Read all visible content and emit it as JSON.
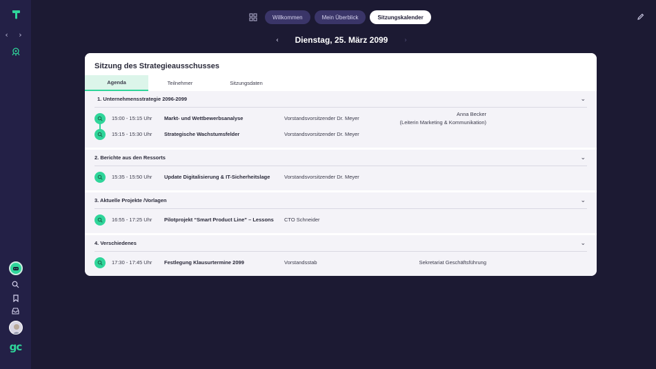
{
  "sidebar": {
    "nav_arrows": "‹ ›",
    "brand": "gc"
  },
  "topnav": {
    "tabs": [
      {
        "label": "Willkommen",
        "active": false
      },
      {
        "label": "Mein Überblick",
        "active": false
      },
      {
        "label": "Sitzungskalender",
        "active": true
      }
    ]
  },
  "date": {
    "prev": "‹",
    "label": "Dienstag, 25. März 2099",
    "next": "›"
  },
  "card": {
    "title": "Sitzung des Strategieausschusses",
    "tabs": [
      "Agenda",
      "Teilnehmer",
      "Sitzungsdaten"
    ],
    "sections": [
      {
        "title": "1. Unternehmensstrategie 2096-2099",
        "items": [
          {
            "time": "15:00 - 15:15 Uhr",
            "topic": "Markt- und Wettbewerbsanalyse",
            "presenter": "Vorstandsvorsitzender Dr. Meyer",
            "extra_1": "Anna Becker",
            "extra_2": "(Leiterin Marketing & Kommunikation)"
          },
          {
            "time": "15:15 - 15:30 Uhr",
            "topic": "Strategische Wachstumsfelder",
            "presenter": "Vorstandsvorsitzender Dr. Meyer",
            "extra_1": "",
            "extra_2": ""
          }
        ]
      },
      {
        "title": "2. Berichte aus den Ressorts",
        "items": [
          {
            "time": "15:35 - 15:50 Uhr",
            "topic": "Update Digitalisierung & IT-Sicherheitslage",
            "presenter": "Vorstandsvorsitzender Dr. Meyer",
            "extra_1": "",
            "extra_2": ""
          }
        ]
      },
      {
        "title": "3. Aktuelle Projekte /Vorlagen",
        "items": [
          {
            "time": "16:55 - 17:25 Uhr",
            "topic": "Pilotprojekt “Smart Product Line” – Lessons",
            "presenter": "CTO Schneider",
            "extra_1": "",
            "extra_2": ""
          }
        ]
      },
      {
        "title": "4. Verschiedenes",
        "items": [
          {
            "time": "17:30 - 17:45 Uhr",
            "topic": "Festlegung Klausurtermine 2099",
            "presenter": "Vorstandsstab",
            "extra_1": "Sekretariat Geschäftsführung",
            "extra_2": ""
          }
        ]
      }
    ]
  },
  "colors": {
    "background": "#1c1a33",
    "sidebar": "#232046",
    "accent": "#2fd59a",
    "pill": "#3a3568"
  }
}
